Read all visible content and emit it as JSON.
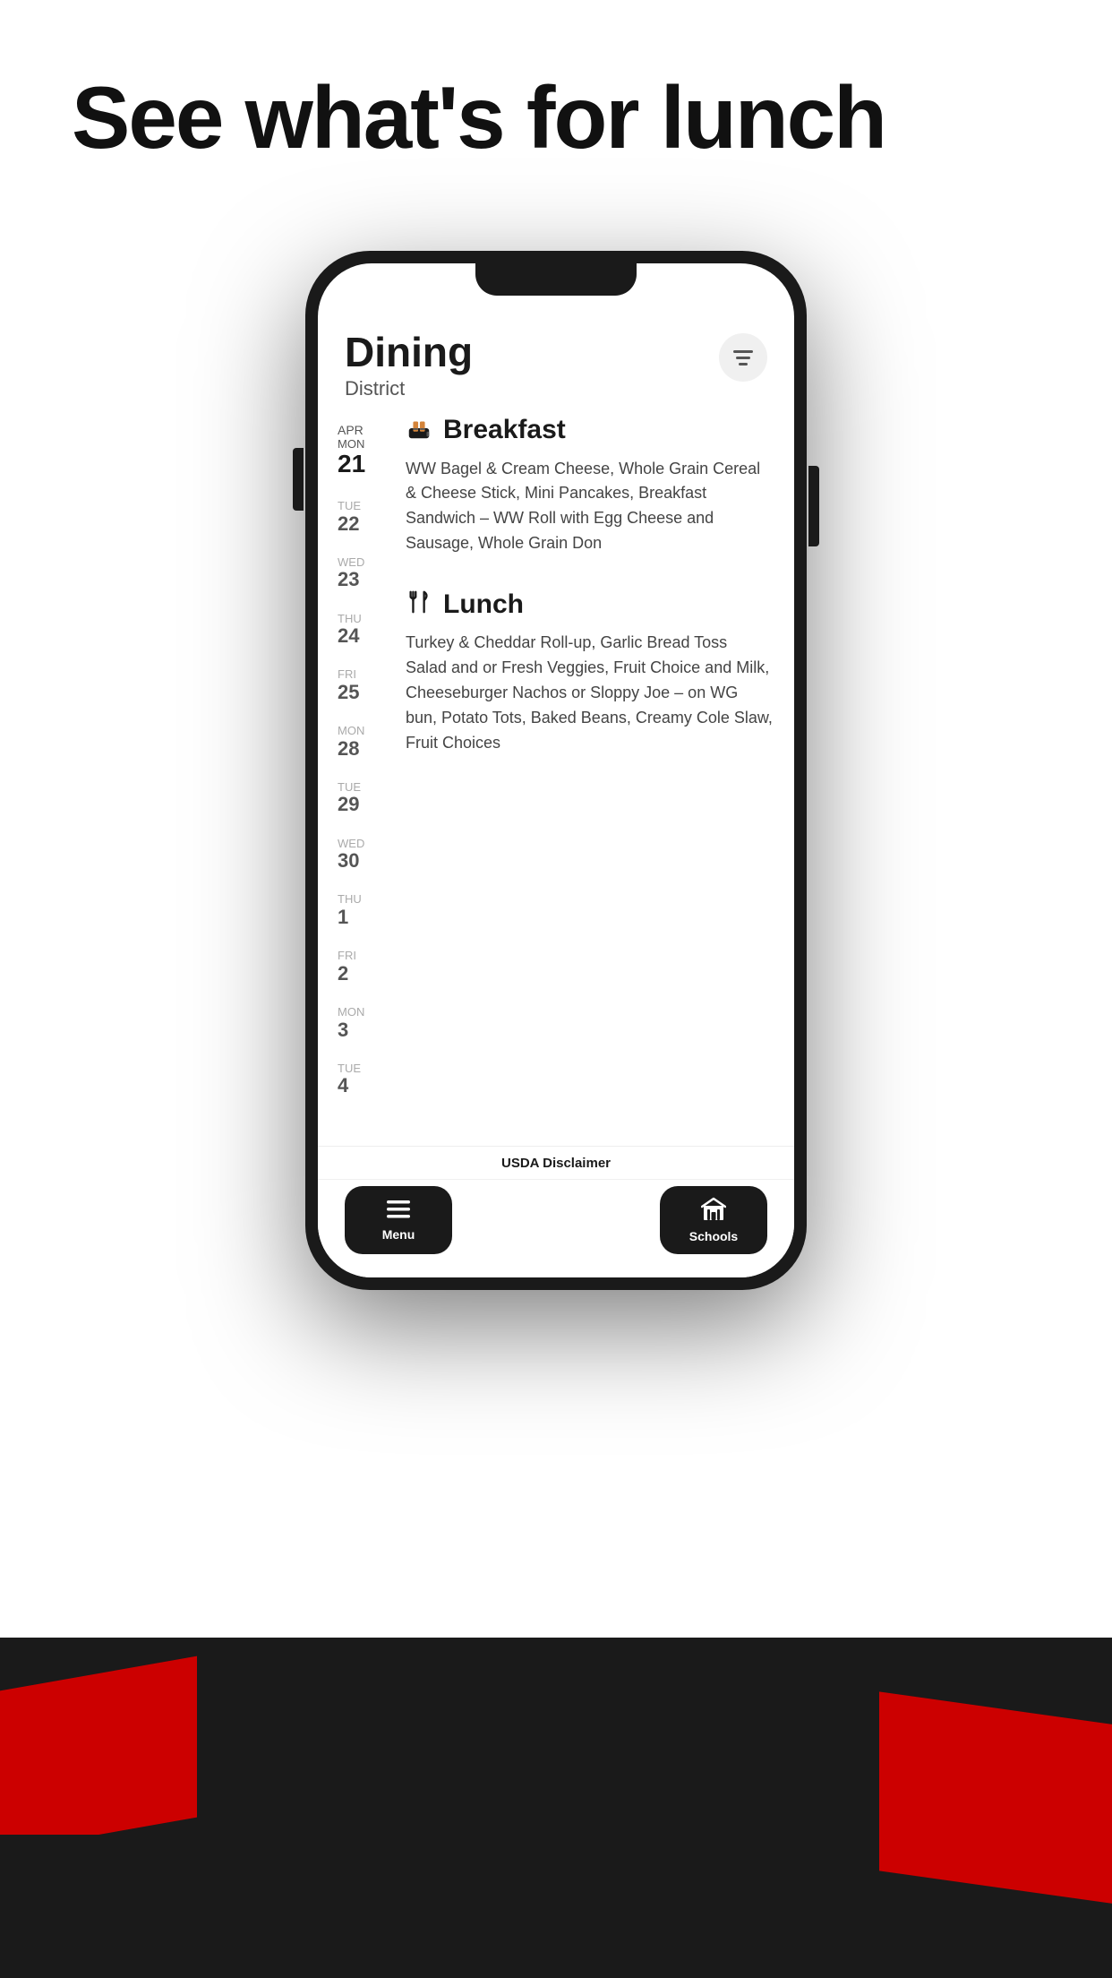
{
  "page": {
    "title": "See what's for lunch"
  },
  "app": {
    "header": {
      "title": "Dining",
      "subtitle": "District"
    },
    "dates": [
      {
        "month": "Apr",
        "day": "MON",
        "num": "21",
        "active": true
      },
      {
        "day": "TUE",
        "num": "22",
        "active": false
      },
      {
        "day": "WED",
        "num": "23",
        "active": false
      },
      {
        "day": "THU",
        "num": "24",
        "active": false
      },
      {
        "day": "FRI",
        "num": "25",
        "active": false
      },
      {
        "day": "MON",
        "num": "28",
        "active": false
      },
      {
        "day": "TUE",
        "num": "29",
        "active": false
      },
      {
        "day": "WED",
        "num": "30",
        "active": false
      },
      {
        "day": "THU",
        "num": "1",
        "active": false
      },
      {
        "day": "FRI",
        "num": "2",
        "active": false
      },
      {
        "day": "MON",
        "num": "3",
        "active": false
      },
      {
        "day": "TUE",
        "num": "4",
        "active": false
      }
    ],
    "meals": [
      {
        "id": "breakfast",
        "title": "Breakfast",
        "icon": "toast",
        "description": "WW Bagel & Cream Cheese, Whole Grain Cereal & Cheese Stick, Mini Pancakes, Breakfast Sandwich – WW Roll with Egg Cheese and Sausage, Whole Grain Don"
      },
      {
        "id": "lunch",
        "title": "Lunch",
        "icon": "fork-knife",
        "description": "Turkey & Cheddar Roll-up, Garlic Bread Toss Salad and or Fresh Veggies, Fruit Choice and Milk, Cheeseburger Nachos or Sloppy Joe – on WG bun, Potato Tots, Baked Beans, Creamy Cole Slaw, Fruit Choices"
      }
    ],
    "disclaimer": "USDA Disclaimer",
    "nav": {
      "menu_label": "Menu",
      "schools_label": "Schools"
    }
  }
}
